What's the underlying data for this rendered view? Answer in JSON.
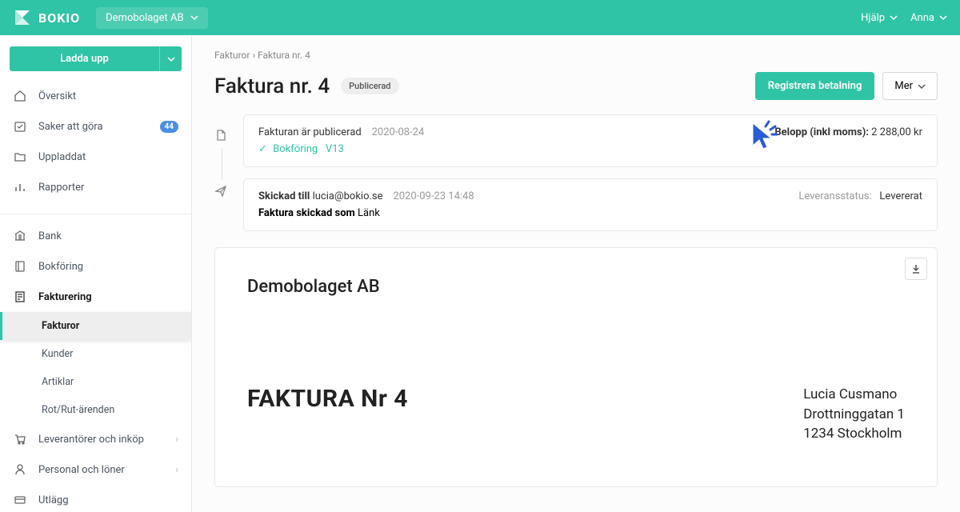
{
  "topbar": {
    "brand": "BOKIO",
    "company": "Demobolaget AB",
    "help": "Hjälp",
    "user": "Anna"
  },
  "sidebar": {
    "upload": "Ladda upp",
    "items": [
      {
        "label": "Översikt"
      },
      {
        "label": "Saker att göra",
        "badge": "44"
      },
      {
        "label": "Uppladdat"
      },
      {
        "label": "Rapporter"
      }
    ],
    "group2": [
      {
        "label": "Bank"
      },
      {
        "label": "Bokföring"
      },
      {
        "label": "Fakturering",
        "active": true
      }
    ],
    "subitems": [
      {
        "label": "Fakturor",
        "selected": true
      },
      {
        "label": "Kunder"
      },
      {
        "label": "Artiklar"
      },
      {
        "label": "Rot/Rut-ärenden"
      }
    ],
    "group3": [
      {
        "label": "Leverantörer och inköp"
      },
      {
        "label": "Personal och löner"
      },
      {
        "label": "Utlägg"
      }
    ]
  },
  "breadcrumb": {
    "parent": "Fakturor",
    "sep": "›",
    "current": "Faktura nr. 4"
  },
  "page": {
    "title": "Faktura nr. 4",
    "status": "Publicerad",
    "action_primary": "Registrera betalning",
    "action_more": "Mer"
  },
  "timeline": {
    "published": {
      "label": "Fakturan är publicerad",
      "date": "2020-08-24",
      "bookkeeping_label": "Bokföring",
      "bookkeeping_ref": "V13",
      "amount_label": "Belopp (inkl moms):",
      "amount_value": "2 288,00 kr"
    },
    "sent": {
      "label": "Skickad till",
      "email": "lucia@bokio.se",
      "datetime": "2020-09-23 14:48",
      "method_label": "Faktura skickad som",
      "method_value": "Länk",
      "delivery_label": "Leveransstatus:",
      "delivery_value": "Levererat"
    }
  },
  "invoice": {
    "company": "Demobolaget AB",
    "title": "FAKTURA Nr 4",
    "customer_name": "Lucia Cusmano",
    "customer_street": "Drottninggatan 1",
    "customer_city": "1234 Stockholm"
  }
}
